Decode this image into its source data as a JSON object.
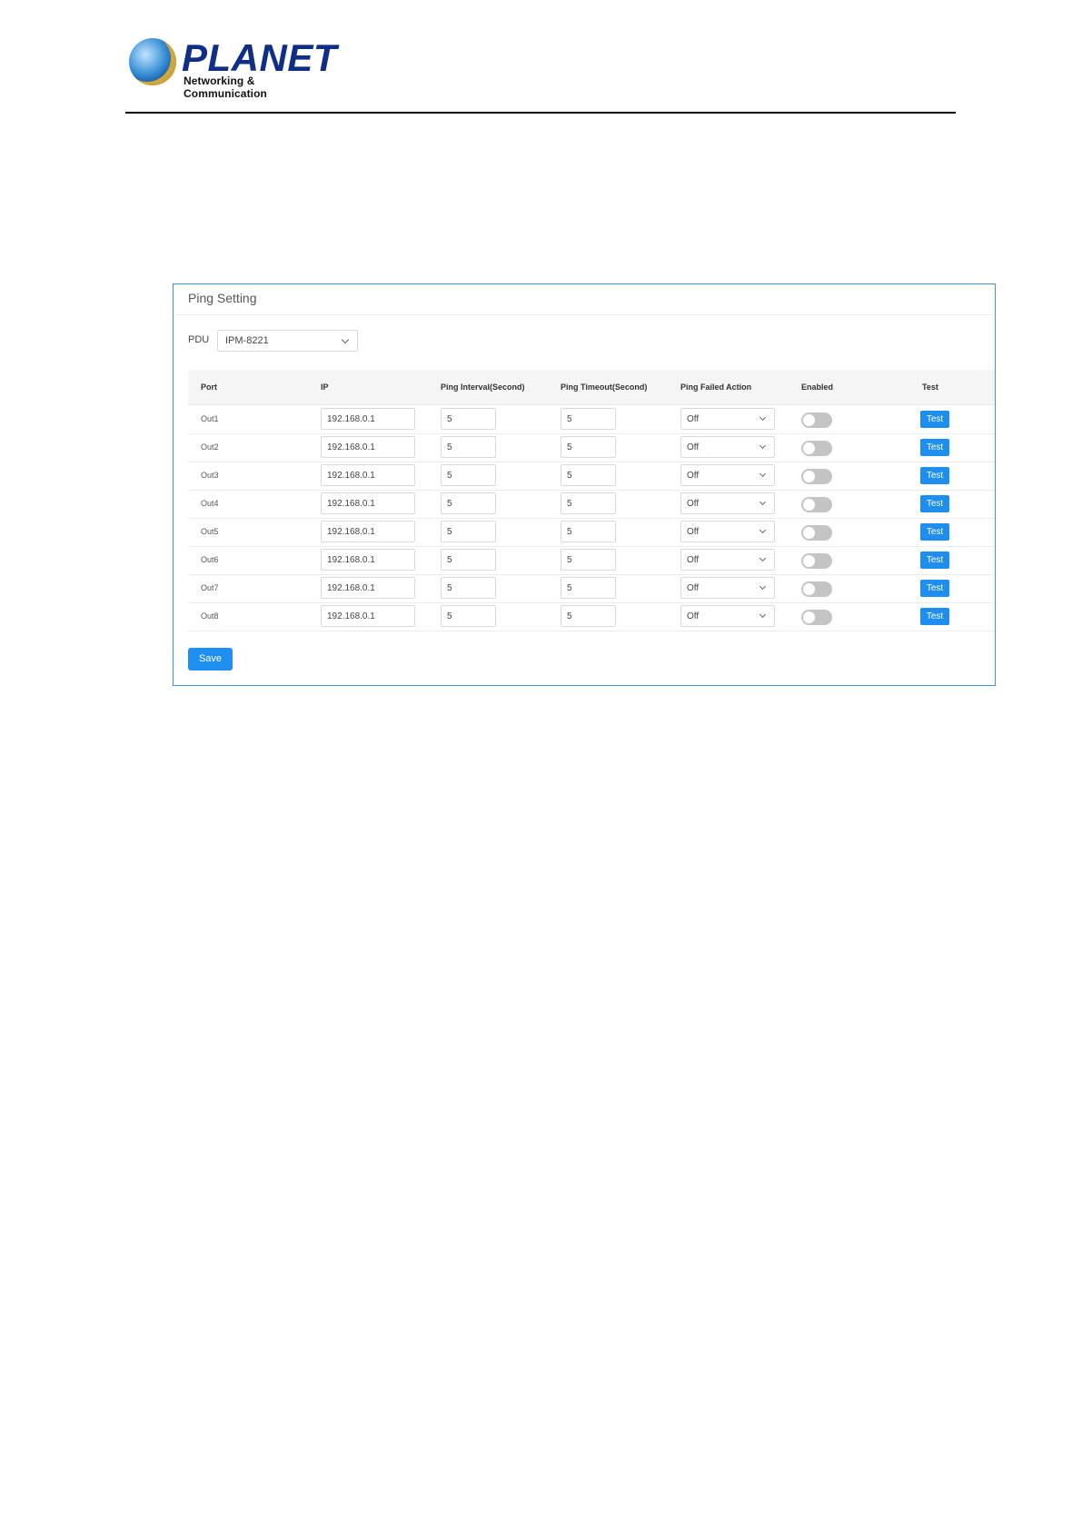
{
  "brand": {
    "name": "PLANET",
    "tagline": "Networking & Communication"
  },
  "panel": {
    "title": "Ping Setting",
    "pdu": {
      "label": "PDU",
      "selected": "IPM-8221"
    },
    "columns": [
      "Port",
      "IP",
      "Ping Interval(Second)",
      "Ping Timeout(Second)",
      "Ping Failed Action",
      "Enabled",
      "Test"
    ],
    "rows": [
      {
        "port": "Out1",
        "ip": "192.168.0.1",
        "interval": "5",
        "timeout": "5",
        "action": "Off",
        "enabled": false,
        "test": "Test"
      },
      {
        "port": "Out2",
        "ip": "192.168.0.1",
        "interval": "5",
        "timeout": "5",
        "action": "Off",
        "enabled": false,
        "test": "Test"
      },
      {
        "port": "Out3",
        "ip": "192.168.0.1",
        "interval": "5",
        "timeout": "5",
        "action": "Off",
        "enabled": false,
        "test": "Test"
      },
      {
        "port": "Out4",
        "ip": "192.168.0.1",
        "interval": "5",
        "timeout": "5",
        "action": "Off",
        "enabled": false,
        "test": "Test"
      },
      {
        "port": "Out5",
        "ip": "192.168.0.1",
        "interval": "5",
        "timeout": "5",
        "action": "Off",
        "enabled": false,
        "test": "Test"
      },
      {
        "port": "Out6",
        "ip": "192.168.0.1",
        "interval": "5",
        "timeout": "5",
        "action": "Off",
        "enabled": false,
        "test": "Test"
      },
      {
        "port": "Out7",
        "ip": "192.168.0.1",
        "interval": "5",
        "timeout": "5",
        "action": "Off",
        "enabled": false,
        "test": "Test"
      },
      {
        "port": "Out8",
        "ip": "192.168.0.1",
        "interval": "5",
        "timeout": "5",
        "action": "Off",
        "enabled": false,
        "test": "Test"
      }
    ],
    "save_label": "Save"
  },
  "colors": {
    "accent": "#1f8ef1",
    "panel_border": "#4a90d6",
    "toggle_off": "#c4c4c4"
  }
}
